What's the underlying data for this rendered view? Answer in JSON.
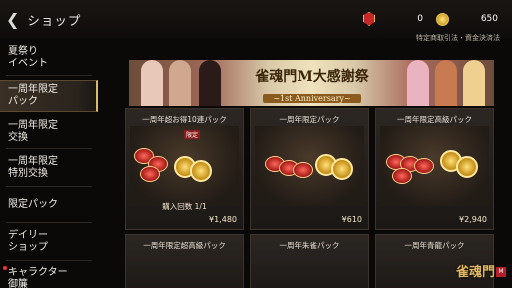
{
  "header": {
    "back_icon": "chevron-left-icon",
    "title": "ショップ"
  },
  "resources": [
    {
      "icon": "red-gem-icon",
      "value": "0"
    },
    {
      "icon": "gold-coin-icon",
      "value": "650"
    }
  ],
  "legal_link": "特定商取引法・資金決済法",
  "sidebar": {
    "items": [
      {
        "label": "夏祭り\nイベント"
      },
      {
        "label": "一周年限定\nパック"
      },
      {
        "label": "一周年限定\n交換"
      },
      {
        "label": "一周年限定\n特別交換"
      },
      {
        "label": "限定パック"
      },
      {
        "label": "デイリー\nショップ"
      },
      {
        "label": "キャラクター\n御簾"
      }
    ]
  },
  "banner": {
    "title": "雀魂門M大感謝祭",
    "subtitle": "~1st Anniversary~"
  },
  "cards": [
    {
      "name": "一周年超お得10連パック",
      "badge": "限定",
      "stamp": "購入回数 1/1",
      "price": "¥1,480"
    },
    {
      "name": "一周年限定パック",
      "price": "¥610"
    },
    {
      "name": "一周年限定高級パック",
      "price": "¥2,940"
    }
  ],
  "cards_row2": [
    {
      "name": "一周年限定超高級パック"
    },
    {
      "name": "一周年朱雀パック"
    },
    {
      "name": "一周年青龍パック"
    }
  ],
  "logo": {
    "text": "雀魂門",
    "mark": "M"
  },
  "colors": {
    "accent_gold": "#d9b96a",
    "panel": "#2c2723",
    "background": "#0b0908"
  }
}
